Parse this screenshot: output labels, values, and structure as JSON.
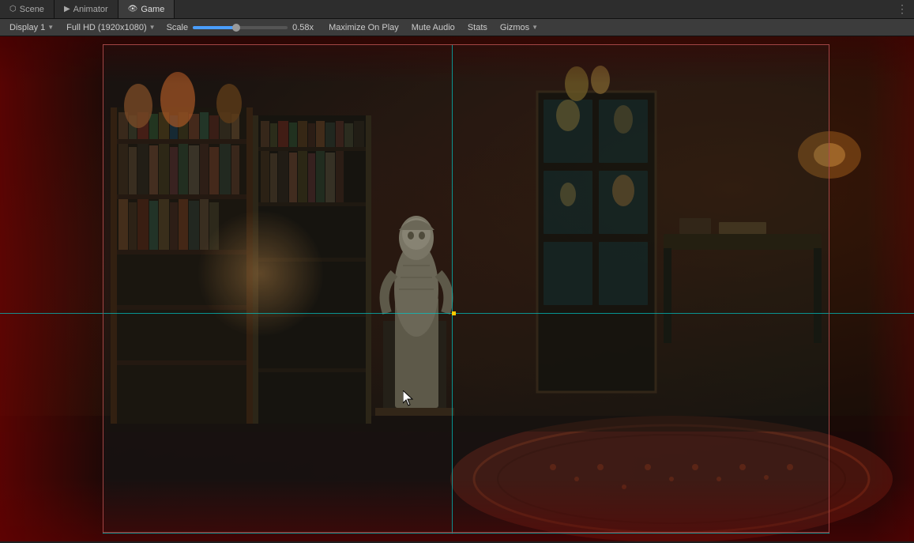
{
  "tabs": [
    {
      "id": "scene",
      "label": "Scene",
      "icon": "⬡",
      "active": false
    },
    {
      "id": "animator",
      "label": "Animator",
      "icon": "▶",
      "active": false
    },
    {
      "id": "game",
      "label": "Game",
      "icon": "👁",
      "active": true
    }
  ],
  "toolbar": {
    "display_label": "Display 1",
    "resolution_label": "Full HD (1920x1080)",
    "scale_label": "Scale",
    "scale_value": "0.58x",
    "maximize_label": "Maximize On Play",
    "mute_label": "Mute Audio",
    "stats_label": "Stats",
    "gizmos_label": "Gizmos"
  },
  "guide_lines": {
    "horizontal_1_pct": 0,
    "horizontal_2_pct": 55,
    "vertical_1_pct": 12,
    "vertical_2_pct": 50
  },
  "colors": {
    "tab_active_bg": "#3c3c3c",
    "tab_bar_bg": "#2d2d2d",
    "toolbar_bg": "#3c3c3c",
    "accent_cyan": "#00c8c8",
    "accent_red": "#c83232",
    "gizmo_yellow": "#ffcc00"
  }
}
